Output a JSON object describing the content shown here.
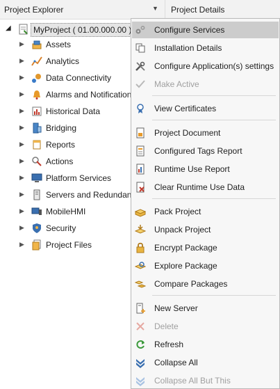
{
  "header": {
    "title": "Project Explorer",
    "dropdown_icon": "caret-down-icon",
    "right_title": "Project Details"
  },
  "tree": {
    "root": {
      "label": "MyProject ( 01.00.000.00 )",
      "icon": "project-icon",
      "expanded": true
    },
    "items": [
      {
        "label": "Assets",
        "icon": "assets-icon"
      },
      {
        "label": "Analytics",
        "icon": "analytics-icon"
      },
      {
        "label": "Data Connectivity",
        "icon": "data-connectivity-icon"
      },
      {
        "label": "Alarms and Notifications",
        "icon": "alarm-icon"
      },
      {
        "label": "Historical Data",
        "icon": "historical-data-icon"
      },
      {
        "label": "Bridging",
        "icon": "bridging-icon"
      },
      {
        "label": "Reports",
        "icon": "reports-icon"
      },
      {
        "label": "Actions",
        "icon": "actions-icon"
      },
      {
        "label": "Platform Services",
        "icon": "platform-services-icon"
      },
      {
        "label": "Servers and Redundancy",
        "icon": "servers-icon"
      },
      {
        "label": "MobileHMI",
        "icon": "mobile-icon"
      },
      {
        "label": "Security",
        "icon": "security-icon"
      },
      {
        "label": "Project Files",
        "icon": "project-files-icon"
      }
    ]
  },
  "menu": {
    "items": [
      {
        "label": "Configure Services",
        "icon": "gears-icon",
        "highlighted": true
      },
      {
        "label": "Installation Details",
        "icon": "copy-icon"
      },
      {
        "label": "Configure Application(s) settings",
        "icon": "tools-icon"
      },
      {
        "label": "Make Active",
        "icon": "checkmark-icon",
        "disabled": true
      },
      {
        "label": "View Certificates",
        "icon": "certificate-icon"
      },
      {
        "label": "Project Document",
        "icon": "document-icon"
      },
      {
        "label": "Configured Tags Report",
        "icon": "tags-report-icon"
      },
      {
        "label": "Runtime Use Report",
        "icon": "runtime-report-icon"
      },
      {
        "label": "Clear Runtime Use Data",
        "icon": "clear-data-icon"
      },
      {
        "label": "Pack Project",
        "icon": "pack-icon"
      },
      {
        "label": "Unpack Project",
        "icon": "unpack-icon"
      },
      {
        "label": "Encrypt Package",
        "icon": "lock-icon"
      },
      {
        "label": "Explore Package",
        "icon": "explore-package-icon"
      },
      {
        "label": "Compare Packages",
        "icon": "compare-packages-icon"
      },
      {
        "label": "New Server",
        "icon": "new-server-icon"
      },
      {
        "label": "Delete",
        "icon": "delete-icon",
        "disabled": true
      },
      {
        "label": "Refresh",
        "icon": "refresh-icon"
      },
      {
        "label": "Collapse All",
        "icon": "collapse-all-icon"
      },
      {
        "label": "Collapse All But This",
        "icon": "collapse-all-but-this-icon",
        "disabled": true
      }
    ]
  }
}
